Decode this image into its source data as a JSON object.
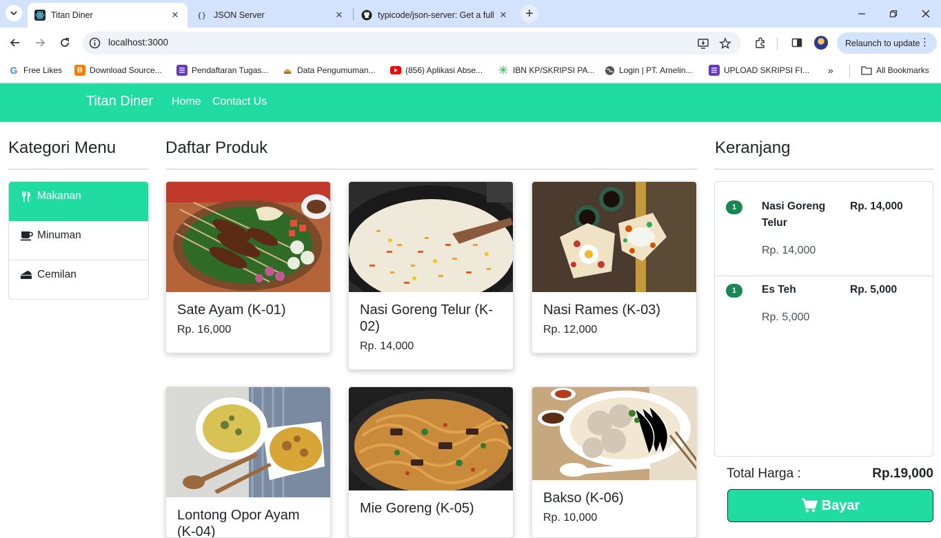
{
  "browser": {
    "tabs": [
      {
        "title": "Titan Diner",
        "icon": "react-icon",
        "active": true
      },
      {
        "title": "JSON Server",
        "icon": "json-icon",
        "active": false
      },
      {
        "title": "typicode/json-server: Get a full",
        "icon": "github-icon",
        "active": false
      }
    ],
    "url": "localhost:3000",
    "relaunch_label": "Relaunch to update",
    "bookmarks": [
      {
        "label": "Free Likes",
        "icon": "g-icon",
        "color": "#4a8be0"
      },
      {
        "label": "Download Source...",
        "icon": "blogger-icon",
        "color": "#f57d00"
      },
      {
        "label": "Pendaftaran Tugas...",
        "icon": "forms-icon",
        "color": "#673ab7"
      },
      {
        "label": "Data Pengumuman...",
        "icon": "emblem-icon",
        "color": "#c9a23a"
      },
      {
        "label": "(856) Aplikasi Abse...",
        "icon": "youtube-icon",
        "color": "#ff0000"
      },
      {
        "label": "IBN KP/SKRIPSI PA...",
        "icon": "asterisk-icon",
        "color": "#21b84a"
      },
      {
        "label": "Login | PT. Arnelin...",
        "icon": "globe-icon",
        "color": "#555555"
      },
      {
        "label": "UPLOAD SKRIPSI FI...",
        "icon": "forms-icon",
        "color": "#673ab7"
      }
    ],
    "all_bookmarks_label": "All Bookmarks"
  },
  "app": {
    "brand": "Titan Diner",
    "nav": [
      "Home",
      "Contact Us"
    ],
    "accent": "#20dca0"
  },
  "categories": {
    "title": "Kategori Menu",
    "items": [
      {
        "label": "Makanan",
        "icon": "utensils-icon",
        "active": true
      },
      {
        "label": "Minuman",
        "icon": "coffee-icon",
        "active": false
      },
      {
        "label": "Cemilan",
        "icon": "cake-icon",
        "active": false
      }
    ]
  },
  "products": {
    "title": "Daftar Produk",
    "items": [
      {
        "name": "Sate Ayam (K-01)",
        "price": "Rp. 16,000"
      },
      {
        "name": "Nasi Goreng Telur (K-02)",
        "price": "Rp. 14,000"
      },
      {
        "name": "Nasi Rames (K-03)",
        "price": "Rp. 12,000"
      },
      {
        "name": "Lontong Opor Ayam (K-04)",
        "price": ""
      },
      {
        "name": "Mie Goreng (K-05)",
        "price": ""
      },
      {
        "name": "Bakso (K-06)",
        "price": "Rp. 10,000"
      }
    ]
  },
  "cart": {
    "title": "Keranjang",
    "items": [
      {
        "qty": "1",
        "name": "Nasi Goreng Telur",
        "total": "Rp. 14,000",
        "unit_price": "Rp. 14,000"
      },
      {
        "qty": "1",
        "name": "Es Teh",
        "total": "Rp. 5,000",
        "unit_price": "Rp. 5,000"
      }
    ],
    "total_label": "Total Harga :",
    "total_value": "Rp.19,000",
    "pay_label": "Bayar"
  }
}
